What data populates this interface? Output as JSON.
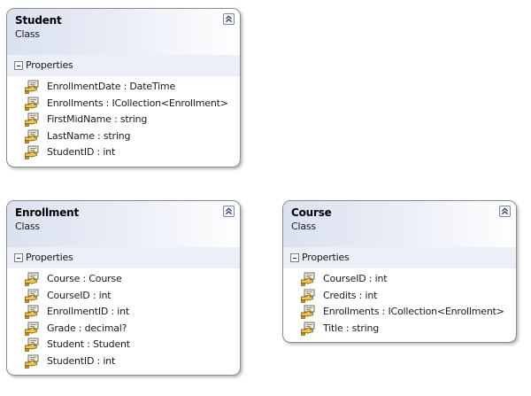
{
  "classes": [
    {
      "name": "Student",
      "kind": "Class",
      "section_label": "Properties",
      "properties": [
        "EnrollmentDate : DateTime",
        "Enrollments : ICollection<Enrollment>",
        "FirstMidName : string",
        "LastName : string",
        "StudentID : int"
      ]
    },
    {
      "name": "Enrollment",
      "kind": "Class",
      "section_label": "Properties",
      "properties": [
        "Course : Course",
        "CourseID : int",
        "EnrollmentID : int",
        "Grade : decimal?",
        "Student : Student",
        "StudentID : int"
      ]
    },
    {
      "name": "Course",
      "kind": "Class",
      "section_label": "Properties",
      "properties": [
        "CourseID : int",
        "Credits : int",
        "Enrollments : ICollection<Enrollment>",
        "Title : string"
      ]
    }
  ],
  "icons": {
    "collapse": "double-chevron-up-icon",
    "section_toggle": "minus-icon",
    "property": "property-icon"
  },
  "colors": {
    "header_gradient_start": "#dbe1ef",
    "section_band": "#ebeff7",
    "border": "#8c8c8c"
  }
}
